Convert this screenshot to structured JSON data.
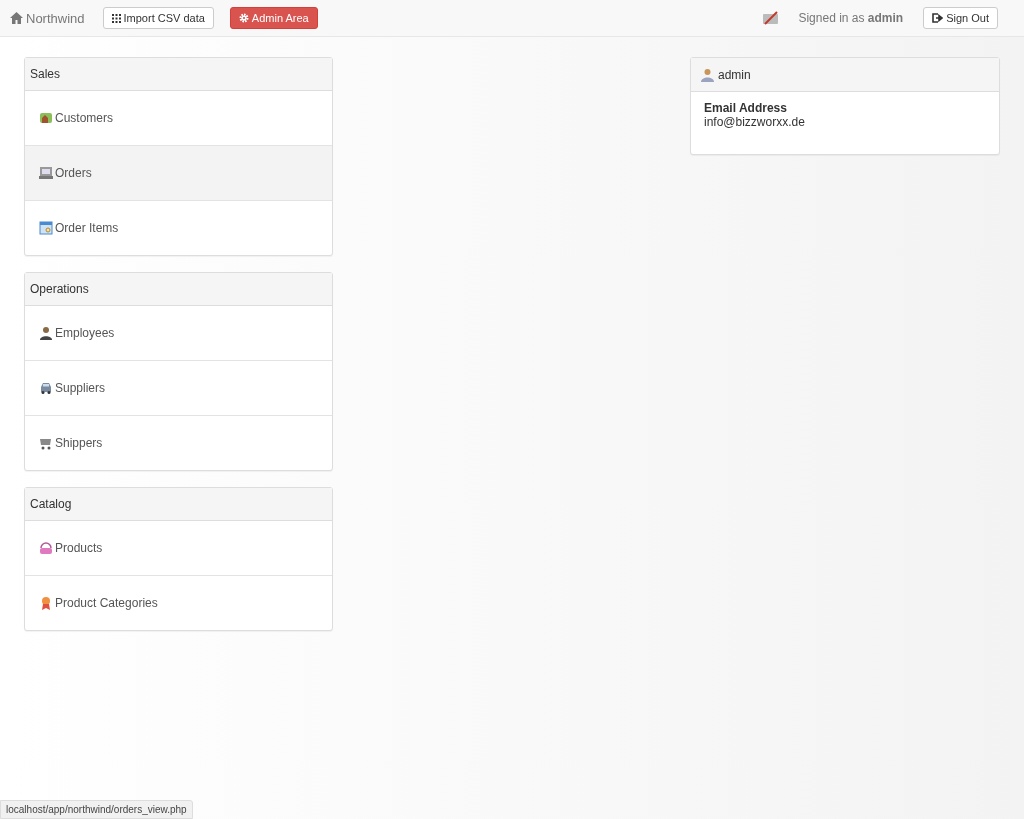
{
  "navbar": {
    "brand": "Northwind",
    "import_button": "Import CSV data",
    "admin_button": "Admin Area",
    "signed_in_prefix": "Signed in as",
    "signed_in_user": "admin",
    "sign_out_button": "Sign Out"
  },
  "groups": [
    {
      "title": "Sales",
      "items": [
        {
          "label": "Customers",
          "kind": "customers",
          "hovered": false
        },
        {
          "label": "Orders",
          "kind": "orders",
          "hovered": true
        },
        {
          "label": "Order Items",
          "kind": "order-items",
          "hovered": false
        }
      ]
    },
    {
      "title": "Operations",
      "items": [
        {
          "label": "Employees",
          "kind": "employees",
          "hovered": false
        },
        {
          "label": "Suppliers",
          "kind": "suppliers",
          "hovered": false
        },
        {
          "label": "Shippers",
          "kind": "shippers",
          "hovered": false
        }
      ]
    },
    {
      "title": "Catalog",
      "items": [
        {
          "label": "Products",
          "kind": "products",
          "hovered": false
        },
        {
          "label": "Product Categories",
          "kind": "categories",
          "hovered": false
        }
      ]
    }
  ],
  "profile": {
    "username": "admin",
    "field_label": "Email Address",
    "field_value": "info@bizzworxx.de"
  },
  "status_bar": "localhost/app/northwind/orders_view.php"
}
